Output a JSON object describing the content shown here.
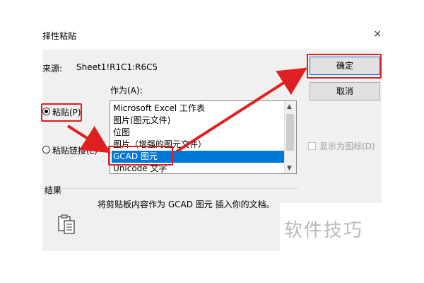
{
  "dialog": {
    "title": "择性粘贴",
    "close_label": "×",
    "source_label": "来源:",
    "source_value": "Sheet1!R1C1:R6C5",
    "as_label": "作为(A):",
    "list_items": [
      "Microsoft Excel 工作表",
      "图片(图元文件)",
      "位图",
      "图片（增强的图元文件）",
      "GCAD 图元",
      "Unicode 文字"
    ],
    "selected_index": 4,
    "paste_label": "粘贴(P)",
    "paste_link_label": "粘贴链接(L)",
    "ok_label": "确定",
    "cancel_label": "取消",
    "display_as_icon_label": "显示为图标(D)",
    "display_as_icon_checked": false,
    "result_label": "结果",
    "result_text": "将剪贴板内容作为 GCAD 图元 插入你的文档。"
  },
  "watermark": {
    "text": "软件技巧"
  },
  "colors": {
    "highlight": "#e02020",
    "selection": "#0078d7",
    "dialog_bg": "#f0f0f0"
  },
  "icons": {
    "clipboard": "clipboard-icon",
    "close": "close-icon"
  }
}
